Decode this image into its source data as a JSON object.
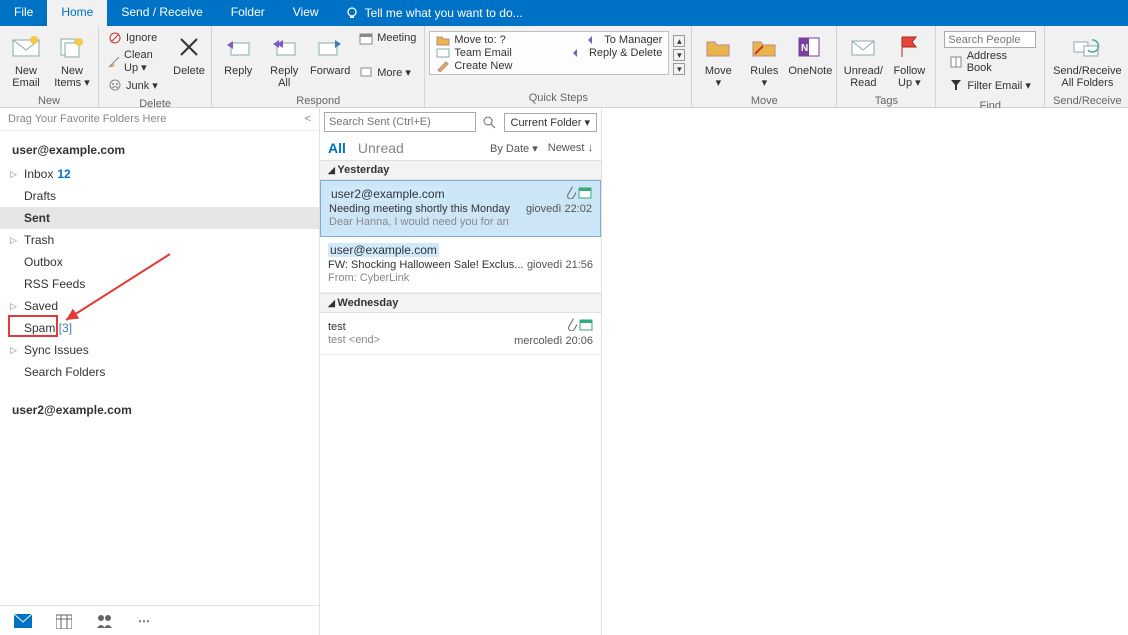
{
  "tabs": {
    "file": "File",
    "home": "Home",
    "sendreceive": "Send / Receive",
    "folder": "Folder",
    "view": "View",
    "tellme": "Tell me what you want to do..."
  },
  "ribbon": {
    "new": {
      "label": "New",
      "newEmail": "New\nEmail",
      "newItems": "New\nItems ▾"
    },
    "delete": {
      "label": "Delete",
      "ignore": "Ignore",
      "cleanUp": "Clean Up ▾",
      "junk": "Junk ▾",
      "delete": "Delete"
    },
    "respond": {
      "label": "Respond",
      "reply": "Reply",
      "replyAll": "Reply\nAll",
      "forward": "Forward",
      "meeting": "Meeting",
      "more": "More ▾"
    },
    "quicksteps": {
      "label": "Quick Steps",
      "moveTo": "Move to: ?",
      "toManager": "To Manager",
      "teamEmail": "Team Email",
      "replyDelete": "Reply & Delete",
      "createNew": "Create New"
    },
    "move": {
      "label": "Move",
      "move": "Move\n▾",
      "rules": "Rules\n▾",
      "onenote": "OneNote"
    },
    "tags": {
      "label": "Tags",
      "unread": "Unread/\nRead",
      "followup": "Follow\nUp ▾"
    },
    "find": {
      "label": "Find",
      "searchPlaceholder": "Search People",
      "addressBook": "Address Book",
      "filterEmail": "Filter Email ▾"
    },
    "sendrec": {
      "label": "Send/Receive",
      "btn": "Send/Receive\nAll Folders"
    }
  },
  "nav": {
    "favPrompt": "Drag Your Favorite Folders Here",
    "account1": "user@example.com",
    "account2": "user2@example.com",
    "folders": {
      "inbox": "Inbox",
      "inboxCount": "12",
      "drafts": "Drafts",
      "sent": "Sent",
      "trash": "Trash",
      "outbox": "Outbox",
      "rss": "RSS Feeds",
      "saved": "Saved",
      "spam": "Spam",
      "spamCount": "[3]",
      "sync": "Sync Issues",
      "search": "Search Folders"
    }
  },
  "list": {
    "searchPlaceholder": "Search Sent (Ctrl+E)",
    "scope": "Current Folder ▾",
    "all": "All",
    "unread": "Unread",
    "byDate": "By Date ▾",
    "newest": "Newest ↓",
    "g1": "Yesterday",
    "m1": {
      "from": "user2@example.com",
      "subj": "Needing meeting shortly this Monday",
      "prev": "Dear Hanna,  I would need you for an",
      "time": "giovedì 22:02"
    },
    "m2": {
      "from": "user@example.com",
      "subj": "FW: Shocking Halloween Sale! Exclus...",
      "prev": "From: CyberLink",
      "time": "giovedì 21:56"
    },
    "g2": "Wednesday",
    "m3": {
      "from": "",
      "subj": "test",
      "prev": "test <end>",
      "time": "mercoledì 20:06"
    }
  }
}
